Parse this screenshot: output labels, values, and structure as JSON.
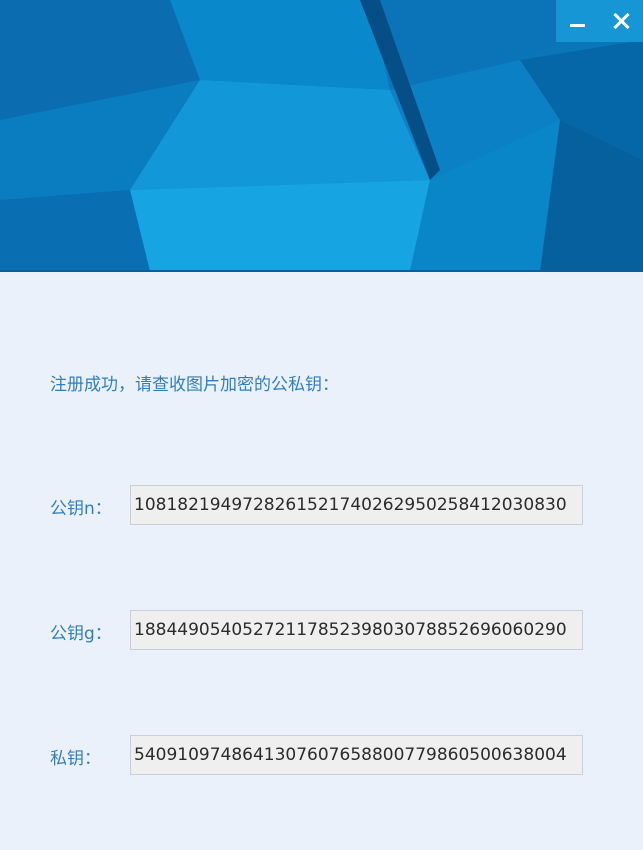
{
  "window": {
    "controls": {
      "minimize_icon": "minimize-icon",
      "close_icon": "close-icon"
    },
    "banner_colors": [
      "#0a76b8",
      "#0895d6",
      "#0b64a8",
      "#1aa6e4",
      "#075894"
    ]
  },
  "main": {
    "message": "注册成功，请查收图片加密的公私钥：",
    "keys": [
      {
        "label": "公钥n：",
        "value": "1081821949728261521740262950258412030830"
      },
      {
        "label": "公钥g：",
        "value": "1884490540527211785239803078852696060290"
      },
      {
        "label": "私钥：",
        "value": "5409109748641307607658800779860500638004"
      }
    ]
  }
}
